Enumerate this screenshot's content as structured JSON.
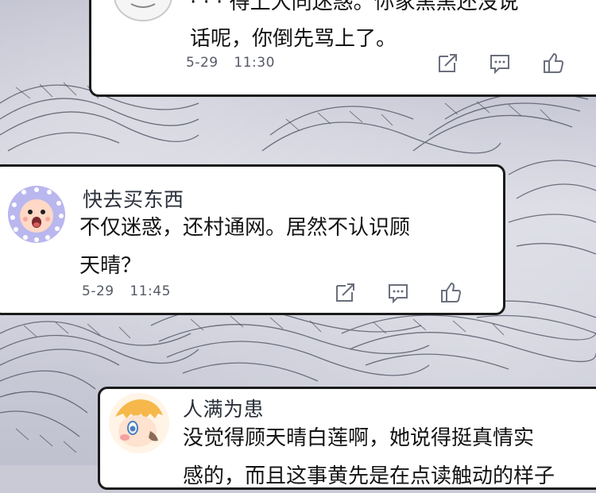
{
  "comments": [
    {
      "text_lines": [
        "· · · 得上大同迷惑。你家黑黑还没说",
        "话呢，你倒先骂上了。"
      ],
      "date": "5-29",
      "time": "11:30"
    },
    {
      "username": "快去买东西",
      "text_lines": [
        "不仅迷惑，还村通网。居然不认识顾",
        "天晴？"
      ],
      "date": "5-29",
      "time": "11:45"
    },
    {
      "username": "人满为患",
      "text_lines": [
        "没觉得顾天晴白莲啊，她说得挺真情实",
        "感的，而且这事黄先是在点读触动的样子"
      ]
    }
  ],
  "icons": {
    "share": "share-icon",
    "reply": "comment-icon",
    "like": "thumbs-up-icon"
  },
  "colors": {
    "bubble_border": "#1b1b1b",
    "avatar2_bg": "#b9b7ee",
    "text": "#131313",
    "meta": "#555a66"
  }
}
